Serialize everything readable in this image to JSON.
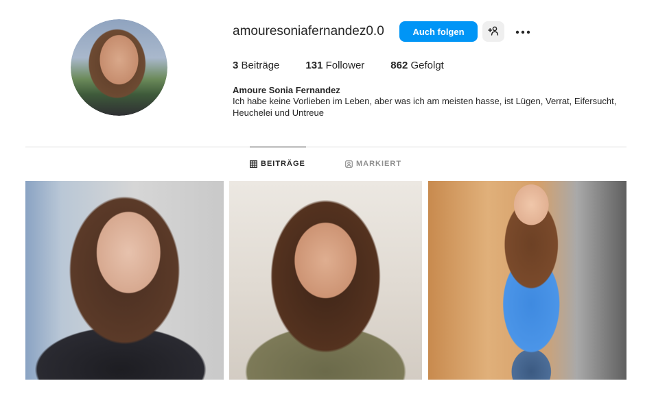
{
  "profile": {
    "username": "amouresoniafernandez0.0",
    "follow_label": "Auch folgen",
    "suggest_icon": "add-person-icon",
    "more_icon": "more-dots-icon",
    "avatar_alt": "profile-avatar"
  },
  "stats": {
    "posts_count": "3",
    "posts_label": "Beiträge",
    "followers_count": "131",
    "followers_label": "Follower",
    "following_count": "862",
    "following_label": "Gefolgt"
  },
  "bio": {
    "full_name": "Amoure Sonia Fernandez",
    "text": "Ich habe keine Vorlieben im Leben, aber was ich am meisten hasse, ist Lügen, Verrat, Eifersucht, Heuchelei und Untreue"
  },
  "tabs": [
    {
      "label": "BEITRÄGE",
      "icon": "grid-icon",
      "active": true
    },
    {
      "label": "MARKIERT",
      "icon": "tagged-person-icon",
      "active": false
    }
  ],
  "posts": [
    {
      "id": "post-1"
    },
    {
      "id": "post-2"
    },
    {
      "id": "post-3"
    }
  ],
  "colors": {
    "accent": "#0095f6",
    "text": "#262626",
    "muted": "#8e8e8e",
    "divider": "#dbdbdb",
    "button_secondary": "#efefef"
  }
}
